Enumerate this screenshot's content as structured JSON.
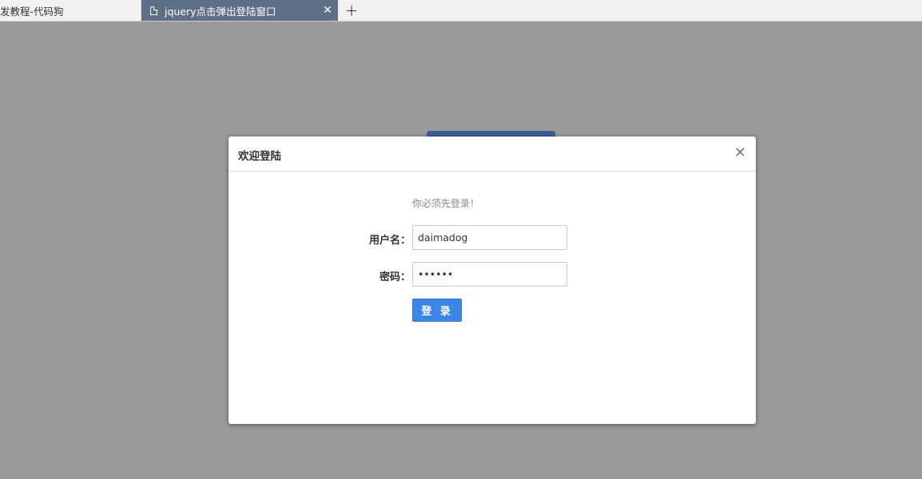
{
  "tabs": [
    {
      "title": "发教程-代码狗",
      "active": false
    },
    {
      "title": "jquery点击弹出登陆窗口",
      "active": true
    }
  ],
  "icons": {
    "tab_page": "page-icon",
    "tab_close": "close-icon",
    "new_tab": "plus-icon",
    "modal_close": "close-icon"
  },
  "glyphs": {
    "tab_close": "✕",
    "new_tab": "+",
    "modal_close": "✕"
  },
  "modal": {
    "title": "欢迎登陆",
    "notice": "你必须先登录！",
    "username_label": "用户名：",
    "username_value": "daimadog",
    "password_label": "密码：",
    "password_value": "123456",
    "login_label": "登 录"
  },
  "colors": {
    "overlay": "#9a9a9a",
    "active_tab": "#5f6f86",
    "login_button": "#3c86e8"
  }
}
